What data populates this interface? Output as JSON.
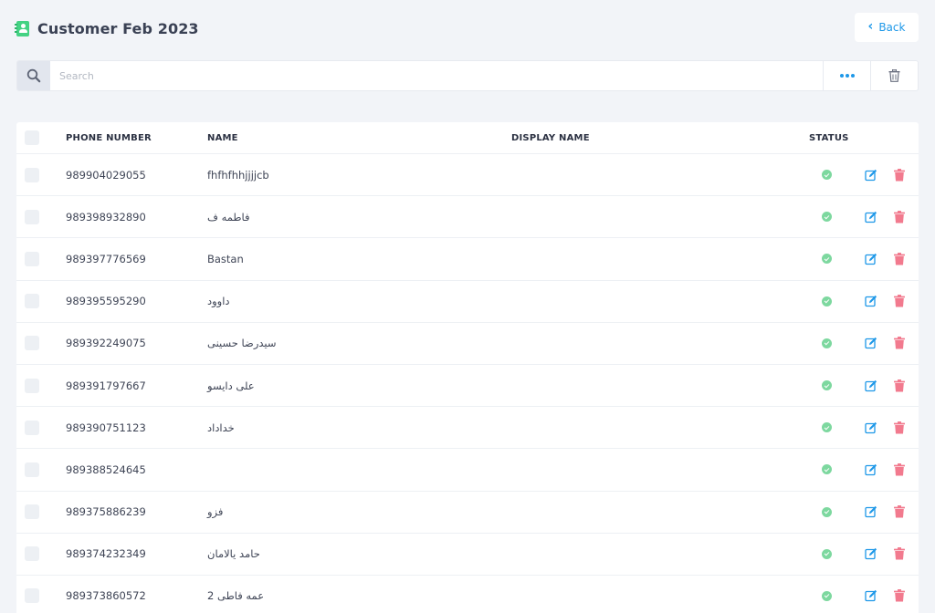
{
  "header": {
    "title": "Customer Feb 2023",
    "back_label": "Back"
  },
  "search": {
    "placeholder": "Search",
    "value": ""
  },
  "table": {
    "columns": {
      "phone": "PHONE NUMBER",
      "name": "NAME",
      "display_name": "DISPLAY NAME",
      "status": "STATUS"
    },
    "rows": [
      {
        "phone": "989904029055",
        "name": "fhfhfhhjjjjcb",
        "display_name": "",
        "status": "active"
      },
      {
        "phone": "989398932890",
        "name": "فاطمه ف",
        "display_name": "",
        "status": "active"
      },
      {
        "phone": "989397776569",
        "name": "Bastan",
        "display_name": "",
        "status": "active"
      },
      {
        "phone": "989395595290",
        "name": "داوود",
        "display_name": "",
        "status": "active"
      },
      {
        "phone": "989392249075",
        "name": "سیدرضا حسینی",
        "display_name": "",
        "status": "active"
      },
      {
        "phone": "989391797667",
        "name": "علی دایسو",
        "display_name": "",
        "status": "active"
      },
      {
        "phone": "989390751123",
        "name": "خداداد",
        "display_name": "",
        "status": "active"
      },
      {
        "phone": "989388524645",
        "name": "",
        "display_name": "",
        "status": "active"
      },
      {
        "phone": "989375886239",
        "name": "فزو",
        "display_name": "",
        "status": "active"
      },
      {
        "phone": "989374232349",
        "name": "حامد یالامان",
        "display_name": "",
        "status": "active"
      },
      {
        "phone": "989373860572",
        "name": "عمه فاطی 2",
        "display_name": "",
        "status": "active"
      }
    ]
  },
  "icons": {
    "header": "contact-book-icon",
    "back": "chevron-left-icon",
    "search": "search-icon",
    "more": "more-dots-icon",
    "trash": "trash-icon",
    "status": "check-circle-icon",
    "edit": "edit-icon",
    "delete": "delete-icon"
  },
  "colors": {
    "accent": "#1e98e8",
    "success": "#7dd89f",
    "danger": "#f27a8e",
    "brand_green": "#44d283"
  }
}
